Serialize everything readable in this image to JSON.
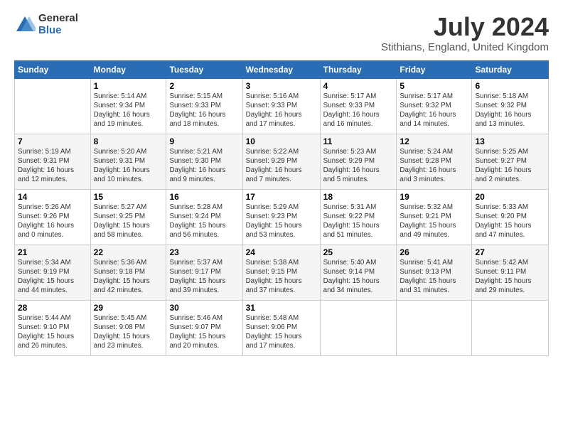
{
  "logo": {
    "general": "General",
    "blue": "Blue"
  },
  "title": "July 2024",
  "location": "Stithians, England, United Kingdom",
  "days_of_week": [
    "Sunday",
    "Monday",
    "Tuesday",
    "Wednesday",
    "Thursday",
    "Friday",
    "Saturday"
  ],
  "weeks": [
    [
      {
        "num": "",
        "info": ""
      },
      {
        "num": "1",
        "info": "Sunrise: 5:14 AM\nSunset: 9:34 PM\nDaylight: 16 hours\nand 19 minutes."
      },
      {
        "num": "2",
        "info": "Sunrise: 5:15 AM\nSunset: 9:33 PM\nDaylight: 16 hours\nand 18 minutes."
      },
      {
        "num": "3",
        "info": "Sunrise: 5:16 AM\nSunset: 9:33 PM\nDaylight: 16 hours\nand 17 minutes."
      },
      {
        "num": "4",
        "info": "Sunrise: 5:17 AM\nSunset: 9:33 PM\nDaylight: 16 hours\nand 16 minutes."
      },
      {
        "num": "5",
        "info": "Sunrise: 5:17 AM\nSunset: 9:32 PM\nDaylight: 16 hours\nand 14 minutes."
      },
      {
        "num": "6",
        "info": "Sunrise: 5:18 AM\nSunset: 9:32 PM\nDaylight: 16 hours\nand 13 minutes."
      }
    ],
    [
      {
        "num": "7",
        "info": "Sunrise: 5:19 AM\nSunset: 9:31 PM\nDaylight: 16 hours\nand 12 minutes."
      },
      {
        "num": "8",
        "info": "Sunrise: 5:20 AM\nSunset: 9:31 PM\nDaylight: 16 hours\nand 10 minutes."
      },
      {
        "num": "9",
        "info": "Sunrise: 5:21 AM\nSunset: 9:30 PM\nDaylight: 16 hours\nand 9 minutes."
      },
      {
        "num": "10",
        "info": "Sunrise: 5:22 AM\nSunset: 9:29 PM\nDaylight: 16 hours\nand 7 minutes."
      },
      {
        "num": "11",
        "info": "Sunrise: 5:23 AM\nSunset: 9:29 PM\nDaylight: 16 hours\nand 5 minutes."
      },
      {
        "num": "12",
        "info": "Sunrise: 5:24 AM\nSunset: 9:28 PM\nDaylight: 16 hours\nand 3 minutes."
      },
      {
        "num": "13",
        "info": "Sunrise: 5:25 AM\nSunset: 9:27 PM\nDaylight: 16 hours\nand 2 minutes."
      }
    ],
    [
      {
        "num": "14",
        "info": "Sunrise: 5:26 AM\nSunset: 9:26 PM\nDaylight: 16 hours\nand 0 minutes."
      },
      {
        "num": "15",
        "info": "Sunrise: 5:27 AM\nSunset: 9:25 PM\nDaylight: 15 hours\nand 58 minutes."
      },
      {
        "num": "16",
        "info": "Sunrise: 5:28 AM\nSunset: 9:24 PM\nDaylight: 15 hours\nand 56 minutes."
      },
      {
        "num": "17",
        "info": "Sunrise: 5:29 AM\nSunset: 9:23 PM\nDaylight: 15 hours\nand 53 minutes."
      },
      {
        "num": "18",
        "info": "Sunrise: 5:31 AM\nSunset: 9:22 PM\nDaylight: 15 hours\nand 51 minutes."
      },
      {
        "num": "19",
        "info": "Sunrise: 5:32 AM\nSunset: 9:21 PM\nDaylight: 15 hours\nand 49 minutes."
      },
      {
        "num": "20",
        "info": "Sunrise: 5:33 AM\nSunset: 9:20 PM\nDaylight: 15 hours\nand 47 minutes."
      }
    ],
    [
      {
        "num": "21",
        "info": "Sunrise: 5:34 AM\nSunset: 9:19 PM\nDaylight: 15 hours\nand 44 minutes."
      },
      {
        "num": "22",
        "info": "Sunrise: 5:36 AM\nSunset: 9:18 PM\nDaylight: 15 hours\nand 42 minutes."
      },
      {
        "num": "23",
        "info": "Sunrise: 5:37 AM\nSunset: 9:17 PM\nDaylight: 15 hours\nand 39 minutes."
      },
      {
        "num": "24",
        "info": "Sunrise: 5:38 AM\nSunset: 9:15 PM\nDaylight: 15 hours\nand 37 minutes."
      },
      {
        "num": "25",
        "info": "Sunrise: 5:40 AM\nSunset: 9:14 PM\nDaylight: 15 hours\nand 34 minutes."
      },
      {
        "num": "26",
        "info": "Sunrise: 5:41 AM\nSunset: 9:13 PM\nDaylight: 15 hours\nand 31 minutes."
      },
      {
        "num": "27",
        "info": "Sunrise: 5:42 AM\nSunset: 9:11 PM\nDaylight: 15 hours\nand 29 minutes."
      }
    ],
    [
      {
        "num": "28",
        "info": "Sunrise: 5:44 AM\nSunset: 9:10 PM\nDaylight: 15 hours\nand 26 minutes."
      },
      {
        "num": "29",
        "info": "Sunrise: 5:45 AM\nSunset: 9:08 PM\nDaylight: 15 hours\nand 23 minutes."
      },
      {
        "num": "30",
        "info": "Sunrise: 5:46 AM\nSunset: 9:07 PM\nDaylight: 15 hours\nand 20 minutes."
      },
      {
        "num": "31",
        "info": "Sunrise: 5:48 AM\nSunset: 9:06 PM\nDaylight: 15 hours\nand 17 minutes."
      },
      {
        "num": "",
        "info": ""
      },
      {
        "num": "",
        "info": ""
      },
      {
        "num": "",
        "info": ""
      }
    ]
  ]
}
